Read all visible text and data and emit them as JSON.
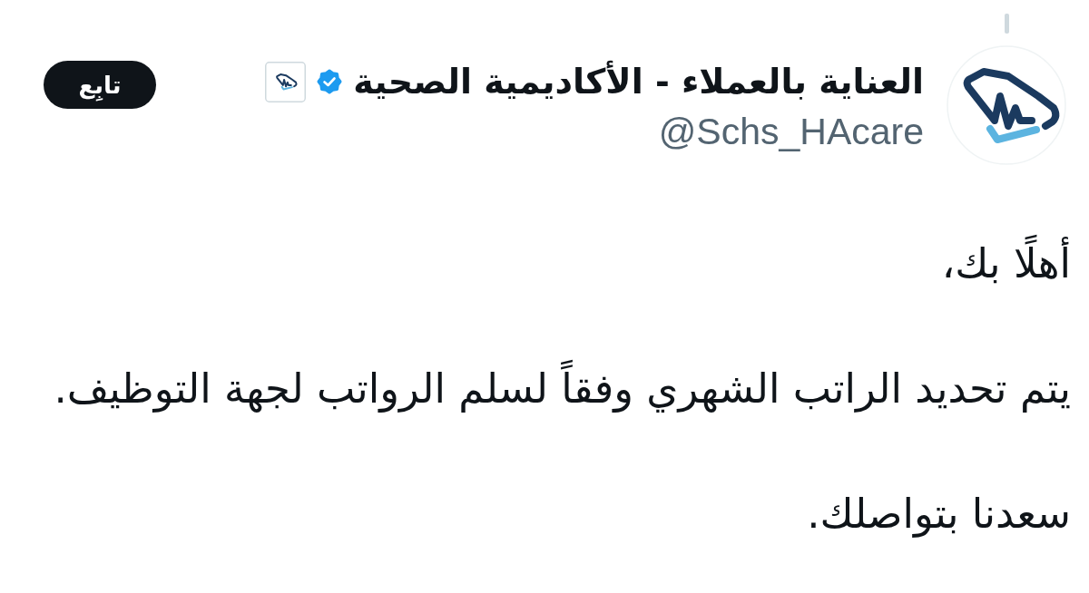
{
  "author": {
    "name": "العناية بالعملاء - الأكاديمية الصحية",
    "handle": "@Schs_HAcare",
    "verified": true,
    "affiliated": true
  },
  "follow_button": {
    "label": "تابِع"
  },
  "tweet": {
    "paragraphs": [
      "أهلًا بك،",
      "يتم تحديد الراتب الشهري وفقاً لسلم الرواتب لجهة التوظيف.",
      "سعدنا بتواصلك."
    ]
  }
}
